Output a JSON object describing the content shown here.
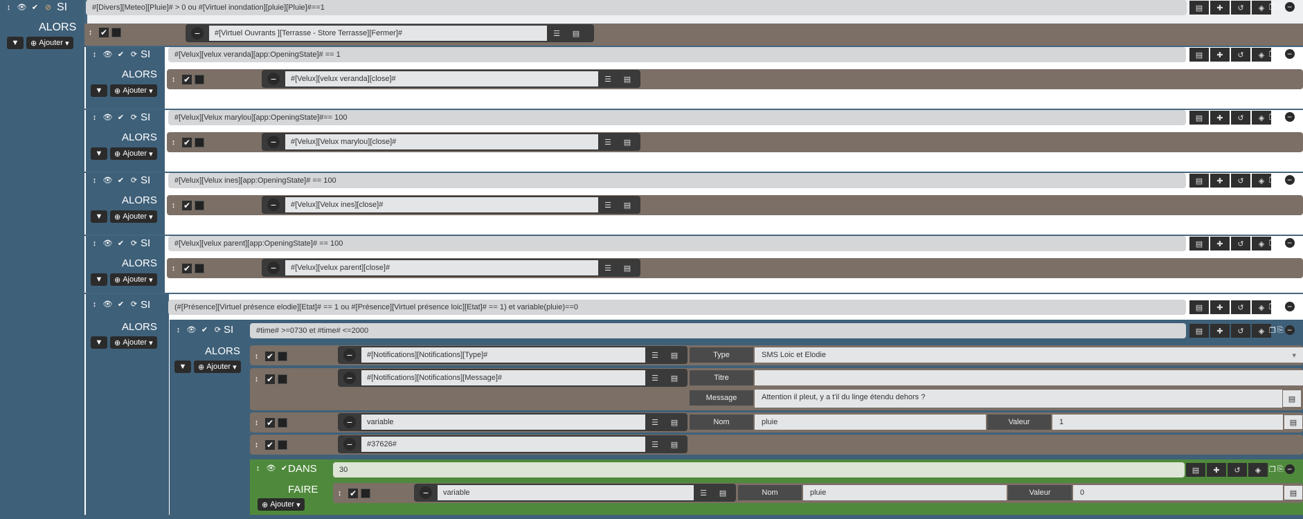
{
  "colors": {
    "block_blue": "#3f6079",
    "action_brown": "#7b6f66",
    "dans_green": "#4f8a3c",
    "page": "#eef0f2"
  },
  "labels": {
    "si": "SI",
    "alors": "ALORS",
    "dans": "DANS",
    "faire": "FAIRE",
    "ajouter": "Ajouter"
  },
  "main": {
    "condition": "#[Divers][Meteo][Pluie]# > 0  ou #[Virtuel inondation][pluie][Pluie]#==1",
    "action": "#[Virtuel Ouvrants ][Terrasse - Store Terrasse][Fermer]#"
  },
  "blocks": [
    {
      "condition": "#[Velux][velux veranda][app:OpeningState]# == 1",
      "action": "#[Velux][velux veranda][close]#"
    },
    {
      "condition": "#[Velux][Velux marylou][app:OpeningState]#== 100",
      "action": "#[Velux][Velux marylou][close]#"
    },
    {
      "condition": "#[Velux][Velux ines][app:OpeningState]# == 100",
      "action": "#[Velux][Velux ines][close]#"
    },
    {
      "condition": "#[Velux][velux parent][app:OpeningState]# == 100",
      "action": "#[Velux][velux parent][close]#"
    }
  ],
  "presence": {
    "condition": "(#[Présence][Virtuel présence elodie][Etat]# == 1  ou #[Présence][Virtuel présence loic][Etat]# == 1) et variable(pluie)==0",
    "time": {
      "condition": "#time# >=0730 et #time# <=2000",
      "actions": [
        {
          "cmd": "#[Notifications][Notifications][Type]#",
          "label": "Type",
          "value": "SMS Loic et Elodie"
        },
        {
          "cmd": "#[Notifications][Notifications][Message]#",
          "titre_label": "Titre",
          "titre_value": "",
          "message_label": "Message",
          "message_value": "Attention il pleut, y a t'il du linge étendu dehors ?"
        },
        {
          "cmd": "variable",
          "nom_label": "Nom",
          "nom_value": "pluie",
          "valeur_label": "Valeur",
          "valeur_value": "1"
        },
        {
          "cmd": "#37626#"
        }
      ],
      "dans": {
        "delay": "30",
        "action": {
          "cmd": "variable",
          "nom_label": "Nom",
          "nom_value": "pluie",
          "valeur_label": "Valeur",
          "valeur_value": "0"
        }
      }
    }
  },
  "icons": [
    "move-icon",
    "eye-icon",
    "check-icon",
    "ban-icon",
    "refresh-icon",
    "list-icon",
    "card-icon",
    "puzzle-icon",
    "history-icon",
    "cube-icon",
    "copy-icon",
    "paste-icon",
    "minus-circle-icon",
    "caret-down-icon",
    "plus-circle-icon"
  ]
}
